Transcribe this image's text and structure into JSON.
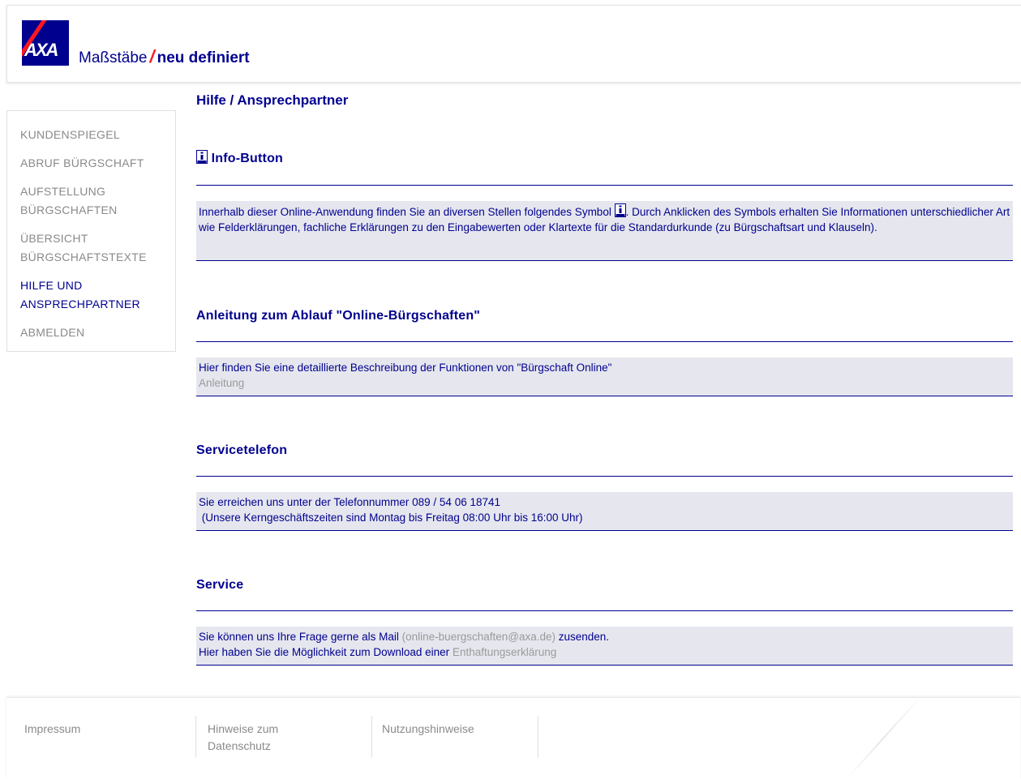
{
  "header": {
    "logo_text": "AXA",
    "tagline_part1": "Maßstäbe",
    "tagline_part2": "neu definiert"
  },
  "sidebar": {
    "items": [
      {
        "label": "KUNDENSPIEGEL"
      },
      {
        "label": "ABRUF BÜRGSCHAFT"
      },
      {
        "label": "AUFSTELLUNG BÜRGSCHAFTEN"
      },
      {
        "label": "ÜBERSICHT BÜRGSCHAFTSTEXTE"
      },
      {
        "label": "HILFE UND ANSPRECHPARTNER"
      },
      {
        "label": "ABMELDEN"
      }
    ]
  },
  "main": {
    "title": "Hilfe / Ansprechpartner",
    "info": {
      "heading": "Info-Button",
      "text_before": "Innerhalb dieser Online-Anwendung finden Sie an diversen Stellen folgendes Symbol",
      "text_after": ". Durch Anklicken des Symbols erhalten Sie Informationen unterschiedlicher Art wie Felderklärungen, fachliche Erklärungen zu den Eingabewerten oder Klartexte für die Standardurkunde (zu Bürgschaftsart und Klauseln)."
    },
    "anleitung": {
      "heading": "Anleitung zum Ablauf \"Online-Bürgschaften\"",
      "text": "Hier finden Sie eine detaillierte Beschreibung der Funktionen von \"Bürgschaft Online\"",
      "link": "Anleitung"
    },
    "telefon": {
      "heading": "Servicetelefon",
      "line1": "Sie erreichen uns unter der Telefonnummer 089 / 54 06 18741",
      "line2": " (Unsere Kerngeschäftszeiten sind Montag bis Freitag 08:00 Uhr bis 16:00 Uhr)"
    },
    "service": {
      "heading": "Service",
      "line1_before": "Sie können uns Ihre Frage gerne als Mail",
      "mail_link": "(online-buergschaften@axa.de)",
      "line1_after": "zusenden.",
      "line2_before": "Hier haben Sie die Möglichkeit zum Download einer",
      "download_link": "Enthaftungserklärung"
    }
  },
  "footer": {
    "links": [
      {
        "line1": "Impressum",
        "line2": ""
      },
      {
        "line1": "Hinweise zum",
        "line2": "Datenschutz"
      },
      {
        "line1": "Nutzungshinweise",
        "line2": ""
      }
    ]
  },
  "colors": {
    "brand_blue": "#00008f",
    "brand_red": "#ff1721",
    "panel_bg": "#e6e7ee",
    "muted_text": "#8a8a8a"
  },
  "icons": {
    "logo": "axa-logo",
    "info": "info-icon"
  }
}
